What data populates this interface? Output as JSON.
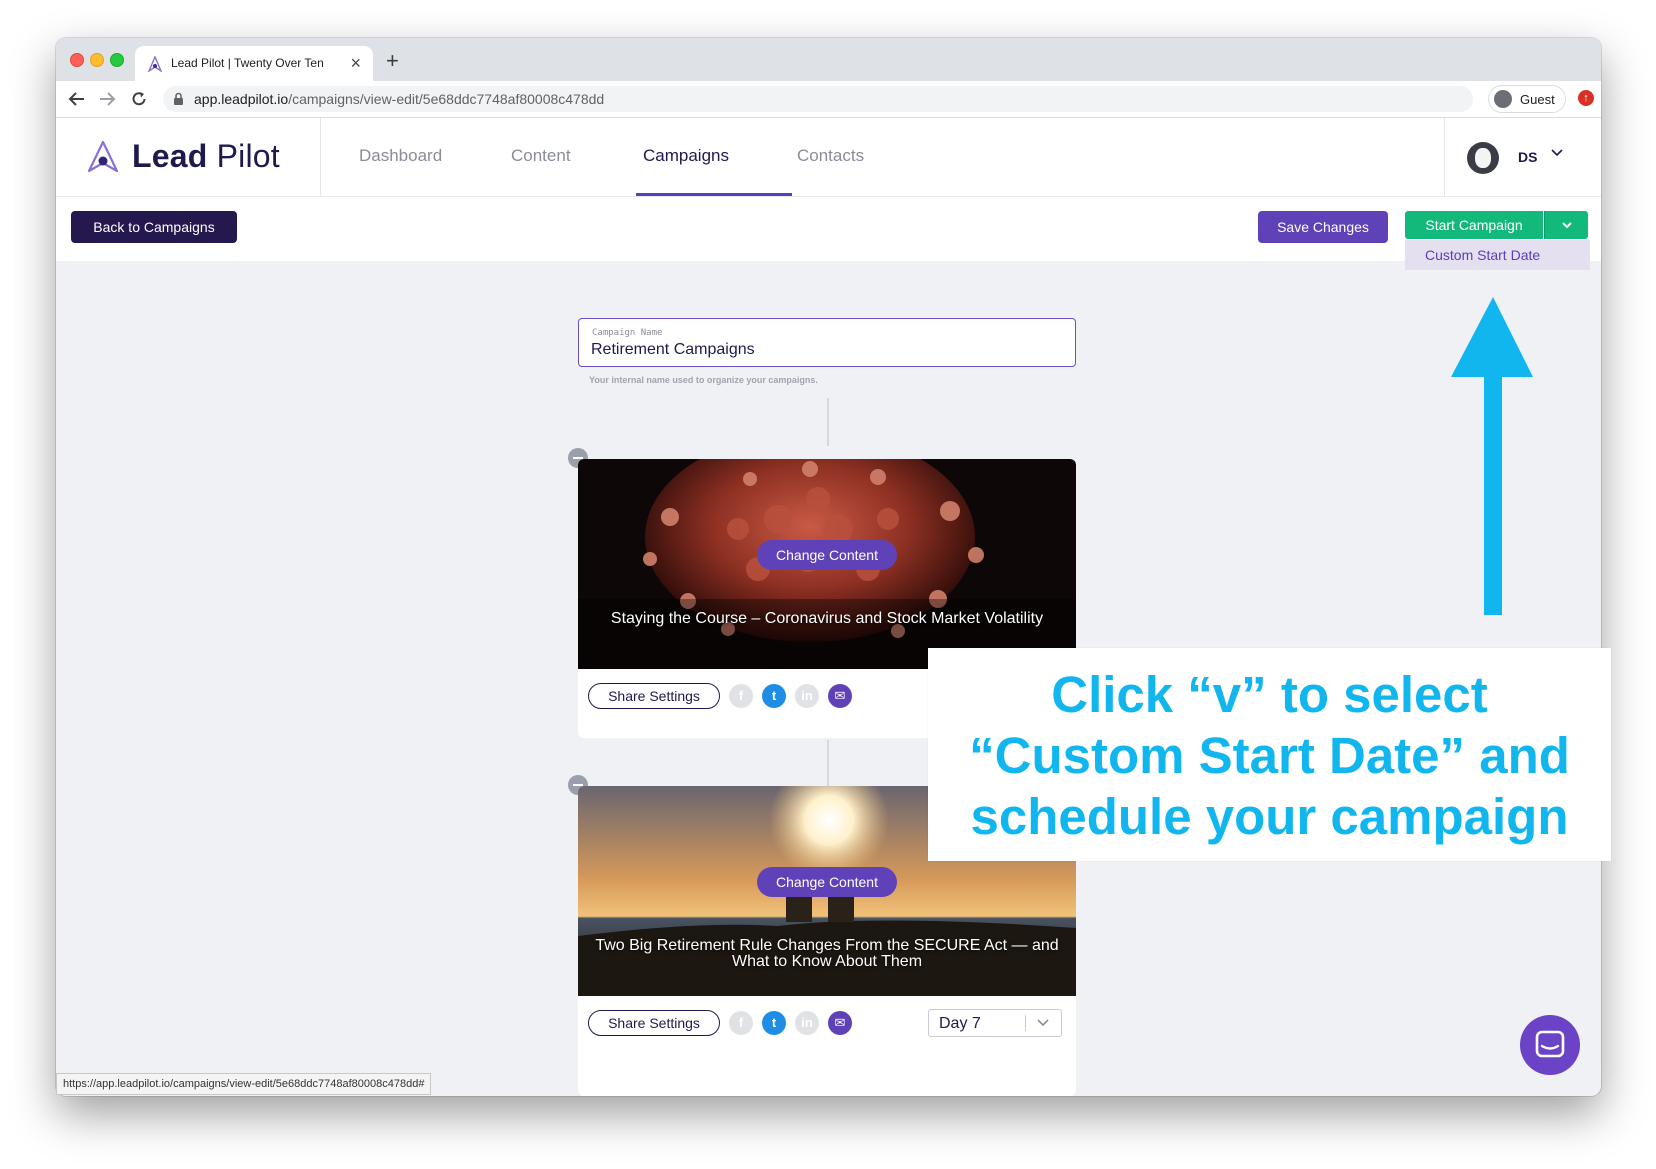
{
  "browser": {
    "tab_title": "Lead Pilot | Twenty Over Ten",
    "tab_close": "×",
    "new_tab": "+",
    "url_host": "app.leadpilot.io",
    "url_path": "/campaigns/view-edit/5e68ddc7748af80008c478dd",
    "profile_label": "Guest",
    "status_url": "https://app.leadpilot.io/campaigns/view-edit/5e68ddc7748af80008c478dd#"
  },
  "header": {
    "logo_bold": "Lead",
    "logo_light": "Pilot",
    "nav": [
      {
        "label": "Dashboard"
      },
      {
        "label": "Content"
      },
      {
        "label": "Campaigns"
      },
      {
        "label": "Contacts"
      }
    ],
    "active_nav": "Campaigns",
    "user_initials": "DS"
  },
  "actions": {
    "back_label": "Back to Campaigns",
    "save_label": "Save Changes",
    "start_label": "Start Campaign",
    "dropdown_item": "Custom Start Date"
  },
  "campaign": {
    "name_label": "Campaign Name",
    "name_value": "Retirement Campaigns",
    "name_help": "Your internal name used to organize your campaigns."
  },
  "cards": [
    {
      "change_label": "Change Content",
      "title_line1": "Staying the Course – Coronavirus and Stock Market Volatility",
      "share_label": "Share Settings"
    },
    {
      "change_label": "Change Content",
      "title_line1": "Two Big Retirement Rule Changes From the SECURE Act — and",
      "title_line2": "What to Know About Them",
      "share_label": "Share Settings",
      "day_value": "Day 7"
    }
  ],
  "annotation": {
    "line1": "Click “v” to select",
    "line2": "“Custom Start Date” and",
    "line3": "schedule your campaign",
    "color": "#12b6ee"
  },
  "icons": [
    "back-arrow-icon",
    "forward-arrow-icon",
    "reload-icon",
    "lock-icon",
    "chevron-down-icon",
    "facebook-icon",
    "twitter-icon",
    "linkedin-icon",
    "email-icon",
    "chat-icon"
  ]
}
